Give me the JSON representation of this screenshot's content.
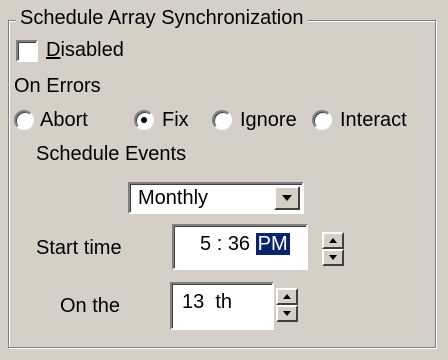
{
  "group": {
    "title": "Schedule Array Synchronization"
  },
  "disabled_checkbox": {
    "label_first": "D",
    "label_rest": "isabled",
    "checked": false
  },
  "on_errors": {
    "label": "On Errors",
    "options": [
      {
        "label": "Abort",
        "checked": false
      },
      {
        "label": "Fix",
        "checked": true
      },
      {
        "label": "Ignore",
        "checked": false
      },
      {
        "label": "Interact",
        "checked": false
      }
    ]
  },
  "schedule_events": {
    "label": "Schedule Events",
    "selected": "Monthly"
  },
  "start_time": {
    "label": "Start time",
    "hour": "5",
    "separator": ":",
    "minute": "36",
    "ampm": "PM"
  },
  "on_the": {
    "label": "On the",
    "day": "13",
    "suffix": "th"
  }
}
